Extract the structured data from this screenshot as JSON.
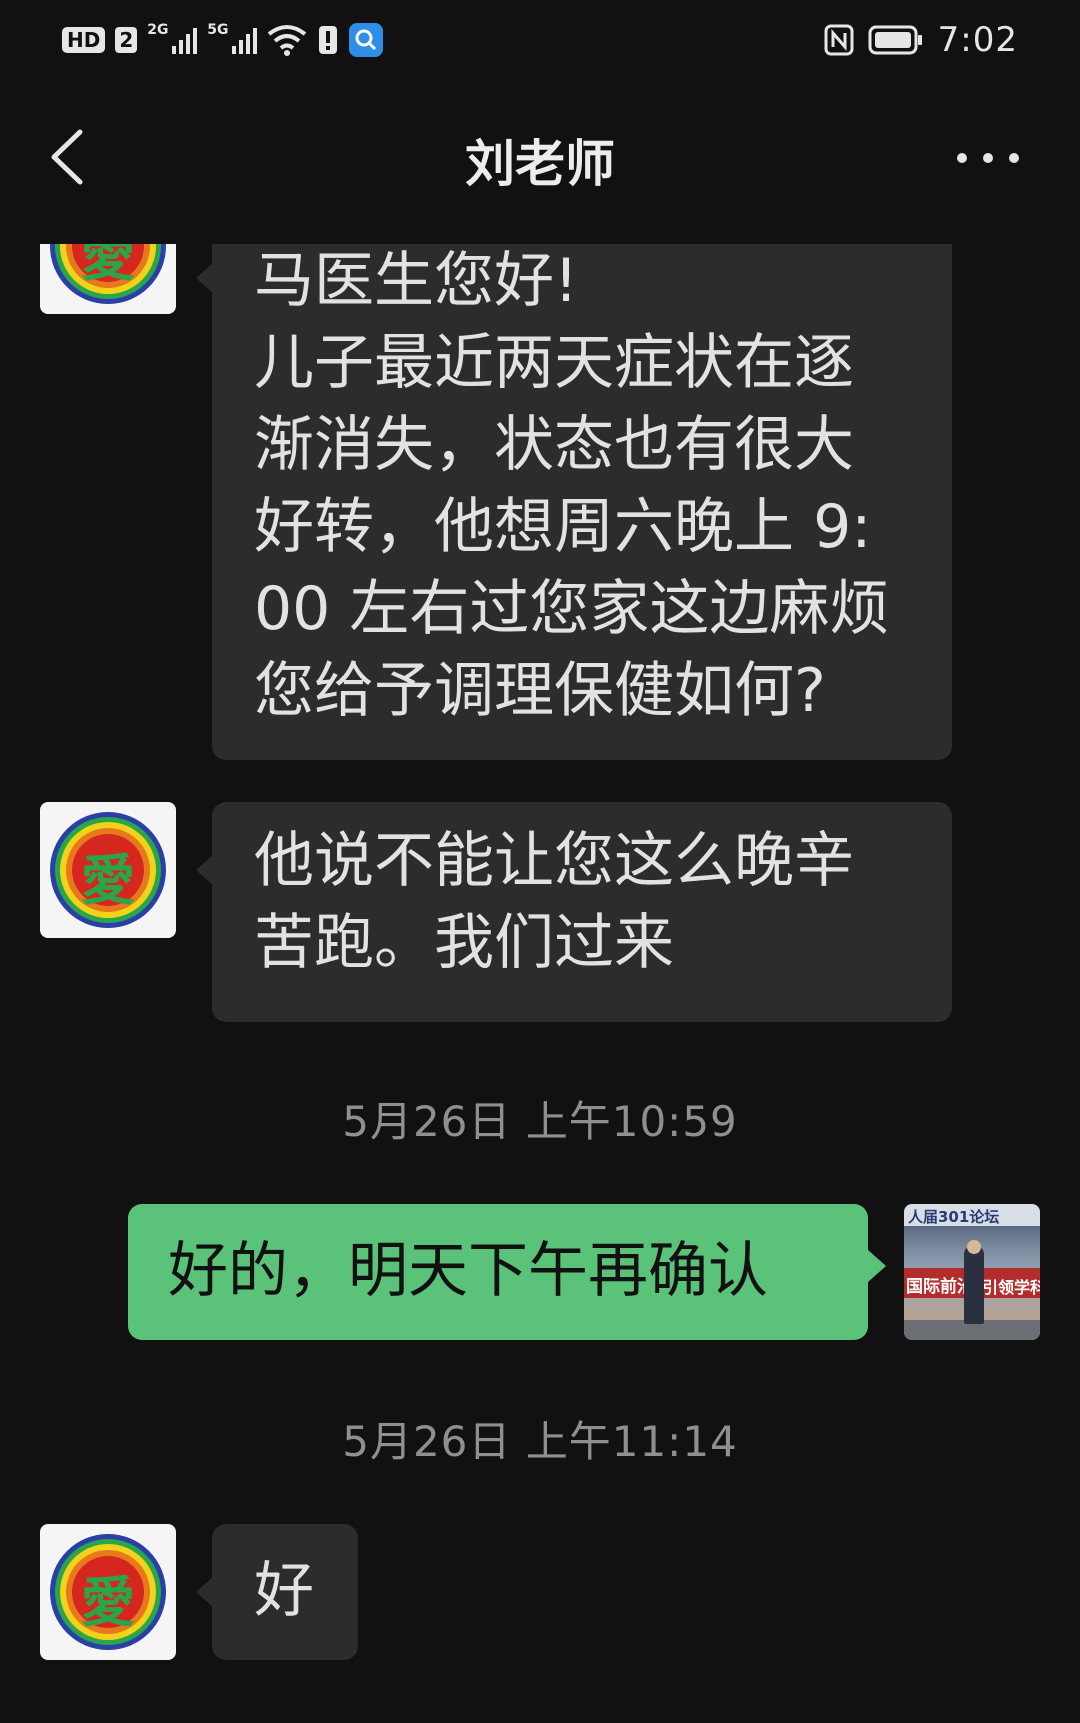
{
  "status_bar": {
    "left_badges": [
      "HD",
      "2"
    ],
    "network_1": "2G",
    "network_2": "5G",
    "time": "7:02",
    "icons": [
      "hd-icon",
      "signal-icon",
      "signal-icon",
      "wifi-icon",
      "alert-icon",
      "search-app-icon",
      "nfc-icon",
      "battery-icon"
    ]
  },
  "header": {
    "title": "刘老师",
    "back_icon": "chevron-left-icon",
    "more_icon": "more-dots-icon"
  },
  "avatar_char": "愛",
  "messages": [
    {
      "direction": "received",
      "lines": [
        "马医生您好!",
        "儿子最近两天症状在逐",
        "渐消失，状态也有很大",
        "好转，他想周六晚上 9:",
        "00 左右过您家这边麻烦",
        "您给予调理保健如何?"
      ]
    },
    {
      "direction": "received",
      "lines": [
        "他说不能让您这么晚辛",
        "苦跑。我们过来"
      ]
    },
    {
      "type": "timestamp",
      "text": "5月26日 上午10:59"
    },
    {
      "direction": "sent",
      "lines": [
        "好的，明天下午再确认"
      ],
      "avatar_banner": "人届301论坛",
      "avatar_left": "国际前沿",
      "avatar_right": "引领学科"
    },
    {
      "type": "timestamp",
      "text": "5月26日 上午11:14"
    },
    {
      "direction": "received",
      "lines": [
        "好"
      ]
    }
  ],
  "colors": {
    "background": "#111111",
    "received_bubble": "#2c2c2c",
    "sent_bubble": "#5bc27a",
    "timestamp": "#8f8f8f"
  }
}
